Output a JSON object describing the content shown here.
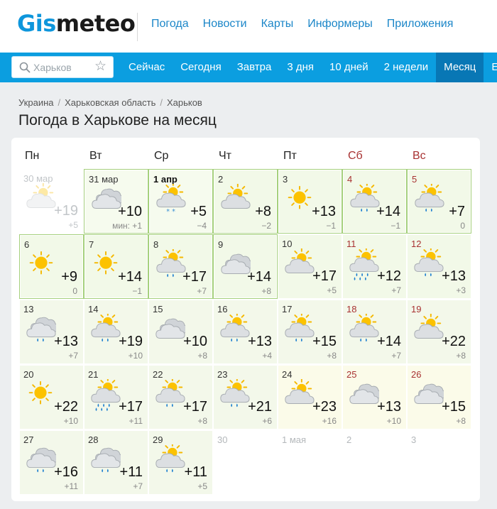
{
  "brand": {
    "part1": "Gis",
    "part2": "meteo"
  },
  "main_nav": [
    "Погода",
    "Новости",
    "Карты",
    "Информеры",
    "Приложения"
  ],
  "search": {
    "placeholder": "Харьков"
  },
  "tabs": [
    "Сейчас",
    "Сегодня",
    "Завтра",
    "3 дня",
    "10 дней",
    "2 недели",
    "Месяц",
    "Ещё"
  ],
  "active_tab": "Месяц",
  "breadcrumb": [
    "Украина",
    "Харьковская область",
    "Харьков"
  ],
  "page_title": "Погода в Харькове на месяц",
  "weekdays": [
    "Пн",
    "Вт",
    "Ср",
    "Чт",
    "Пт",
    "Сб",
    "Вс"
  ],
  "colors": {
    "accent_blue": "#0b9ee0",
    "active_tab": "#0877b5",
    "link": "#1b86c8",
    "weekend_red": "#a83232",
    "current_week_border": "#a5d07c"
  },
  "days": [
    {
      "d": "30 мар",
      "max": "+19",
      "min": "+5",
      "icon": "partly-cloudy",
      "state": "past"
    },
    {
      "d": "31 мар",
      "max": "+10",
      "min": "мин: +1",
      "icon": "cloudy",
      "state": "current"
    },
    {
      "d": "1 апр",
      "max": "+5",
      "min": "−4",
      "icon": "partly-cloudy-snow",
      "state": "current",
      "bold": true
    },
    {
      "d": "2",
      "max": "+8",
      "min": "−2",
      "icon": "partly-cloudy",
      "state": "current"
    },
    {
      "d": "3",
      "max": "+13",
      "min": "−1",
      "icon": "sunny",
      "state": "current"
    },
    {
      "d": "4",
      "max": "+14",
      "min": "−1",
      "icon": "partly-cloudy-rain",
      "state": "current",
      "weekend": true
    },
    {
      "d": "5",
      "max": "+7",
      "min": "0",
      "icon": "partly-cloudy-rain",
      "state": "current",
      "weekend": true
    },
    {
      "d": "6",
      "max": "+9",
      "min": "0",
      "icon": "sunny",
      "state": "current"
    },
    {
      "d": "7",
      "max": "+14",
      "min": "−1",
      "icon": "sunny",
      "state": "current"
    },
    {
      "d": "8",
      "max": "+17",
      "min": "+7",
      "icon": "partly-cloudy-rain",
      "state": "current"
    },
    {
      "d": "9",
      "max": "+14",
      "min": "+8",
      "icon": "cloudy",
      "state": "current"
    },
    {
      "d": "10",
      "max": "+17",
      "min": "+5",
      "icon": "partly-cloudy",
      "state": "future"
    },
    {
      "d": "11",
      "max": "+12",
      "min": "+7",
      "icon": "partly-cloudy-heavy-rain",
      "state": "future",
      "weekend": true
    },
    {
      "d": "12",
      "max": "+13",
      "min": "+3",
      "icon": "partly-cloudy-rain",
      "state": "future",
      "weekend": true
    },
    {
      "d": "13",
      "max": "+13",
      "min": "+7",
      "icon": "cloudy-rain",
      "state": "future"
    },
    {
      "d": "14",
      "max": "+19",
      "min": "+10",
      "icon": "partly-cloudy-rain",
      "state": "future"
    },
    {
      "d": "15",
      "max": "+10",
      "min": "+8",
      "icon": "cloudy",
      "state": "future"
    },
    {
      "d": "16",
      "max": "+13",
      "min": "+4",
      "icon": "partly-cloudy-rain",
      "state": "future"
    },
    {
      "d": "17",
      "max": "+15",
      "min": "+8",
      "icon": "partly-cloudy-rain",
      "state": "future"
    },
    {
      "d": "18",
      "max": "+14",
      "min": "+7",
      "icon": "partly-cloudy-rain",
      "state": "future",
      "weekend": true
    },
    {
      "d": "19",
      "max": "+22",
      "min": "+8",
      "icon": "partly-cloudy",
      "state": "future",
      "weekend": true
    },
    {
      "d": "20",
      "max": "+22",
      "min": "+10",
      "icon": "sunny",
      "state": "future"
    },
    {
      "d": "21",
      "max": "+17",
      "min": "+11",
      "icon": "partly-cloudy-heavy-rain",
      "state": "future"
    },
    {
      "d": "22",
      "max": "+17",
      "min": "+8",
      "icon": "partly-cloudy-rain",
      "state": "future"
    },
    {
      "d": "23",
      "max": "+21",
      "min": "+6",
      "icon": "partly-cloudy-rain",
      "state": "future"
    },
    {
      "d": "24",
      "max": "+23",
      "min": "+16",
      "icon": "partly-cloudy",
      "state": "future"
    },
    {
      "d": "25",
      "max": "+13",
      "min": "+10",
      "icon": "cloudy",
      "state": "future",
      "weekend": true
    },
    {
      "d": "26",
      "max": "+15",
      "min": "+8",
      "icon": "cloudy",
      "state": "future",
      "weekend": true
    },
    {
      "d": "27",
      "max": "+16",
      "min": "+11",
      "icon": "cloudy-rain",
      "state": "future"
    },
    {
      "d": "28",
      "max": "+11",
      "min": "+7",
      "icon": "cloudy-rain",
      "state": "future"
    },
    {
      "d": "29",
      "max": "+11",
      "min": "+5",
      "icon": "partly-cloudy-rain",
      "state": "future"
    },
    {
      "d": "30",
      "state": "other"
    },
    {
      "d": "1 мая",
      "state": "other"
    },
    {
      "d": "2",
      "state": "other"
    },
    {
      "d": "3",
      "state": "other"
    }
  ]
}
